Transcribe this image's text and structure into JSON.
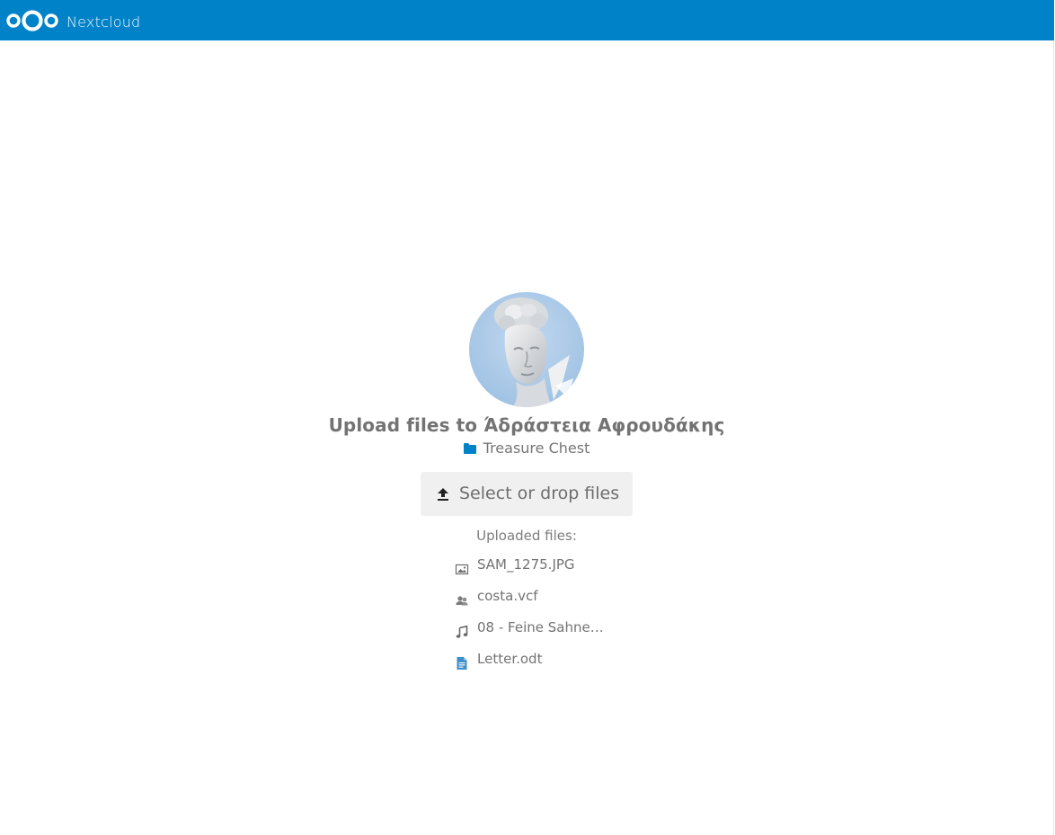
{
  "header": {
    "app_name": "Nextcloud",
    "logo_icon": "nextcloud-logo-icon",
    "background_color": "#0082c9"
  },
  "share": {
    "avatar": "user-avatar-statue",
    "title": "Upload files to Άδράστεια Αφρουδάκης",
    "folder_icon": "folder-icon",
    "folder_name": "Treasure Chest",
    "folder_icon_color": "#0082c9"
  },
  "upload": {
    "icon": "upload-icon",
    "label": "Select or drop files"
  },
  "uploaded": {
    "heading": "Uploaded files:",
    "files": [
      {
        "name": "SAM_1275.JPG",
        "icon": "image-file-icon"
      },
      {
        "name": "costa.vcf",
        "icon": "contacts-file-icon"
      },
      {
        "name": "08 - Feine Sahne…",
        "icon": "audio-file-icon"
      },
      {
        "name": "Letter.odt",
        "icon": "text-document-icon"
      }
    ]
  }
}
